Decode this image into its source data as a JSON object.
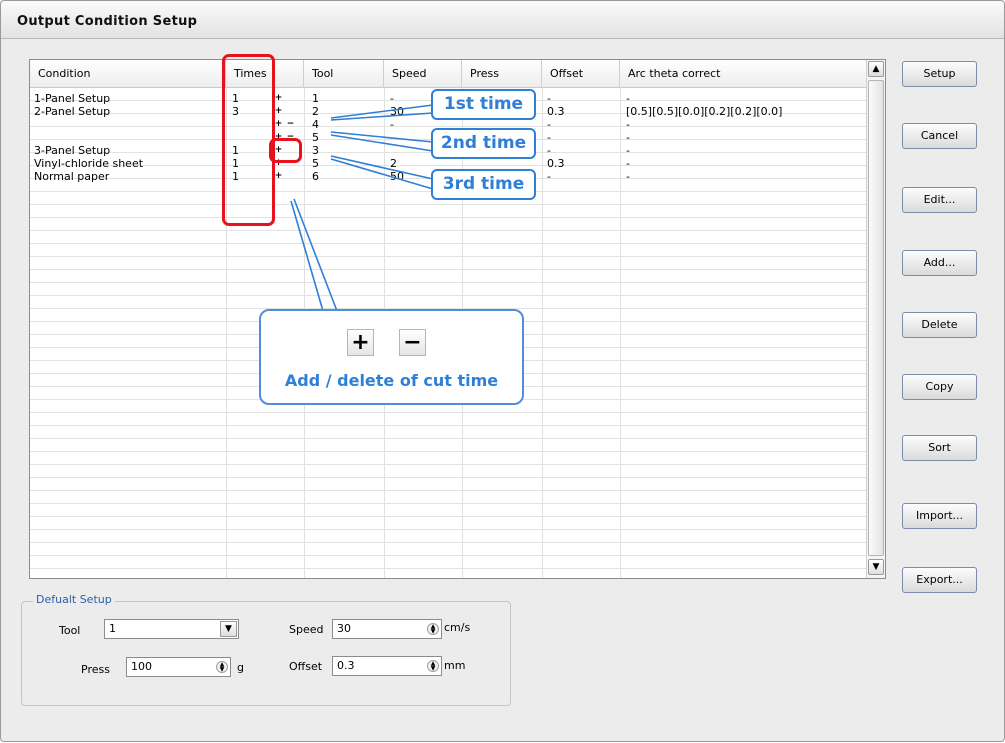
{
  "window": {
    "title": "Output Condition Setup"
  },
  "table": {
    "columns": [
      "Condition",
      "Times",
      "Tool",
      "Speed",
      "Press",
      "Offset",
      "Arc theta correct"
    ],
    "rows": [
      {
        "condition": "1-Panel Setup",
        "times": "1",
        "tool": "1",
        "speed": "-",
        "press": "",
        "offset": "-",
        "arc": "-"
      },
      {
        "condition": "2-Panel Setup",
        "times": "3",
        "tool": "2",
        "speed": "30",
        "press": "150",
        "offset": "0.3",
        "arc": "[0.5][0.5][0.0][0.2][0.2][0.0]"
      },
      {
        "condition": "",
        "times": "",
        "tool": "4",
        "speed": "-",
        "press": "",
        "offset": "-",
        "arc": "-"
      },
      {
        "condition": "",
        "times": "",
        "tool": "5",
        "speed": "-",
        "press": "",
        "offset": "-",
        "arc": "-"
      },
      {
        "condition": "3-Panel Setup",
        "times": "1",
        "tool": "3",
        "speed": "",
        "press": "",
        "offset": "-",
        "arc": "-"
      },
      {
        "condition": "Vinyl-chloride sheet",
        "times": "1",
        "tool": "5",
        "speed": "2",
        "press": "",
        "offset": "0.3",
        "arc": "-"
      },
      {
        "condition": "Normal paper",
        "times": "1",
        "tool": "6",
        "speed": "50",
        "press": "20",
        "offset": "-",
        "arc": "-"
      }
    ]
  },
  "buttons": {
    "setup": "Setup",
    "cancel": "Cancel",
    "edit": "Edit...",
    "add": "Add...",
    "delete": "Delete",
    "copy": "Copy",
    "sort": "Sort",
    "import": "Import...",
    "export": "Export..."
  },
  "default_setup": {
    "group_label": "Defualt Setup",
    "tool_label": "Tool",
    "tool_value": "1",
    "speed_label": "Speed",
    "speed_value": "30",
    "speed_unit": "cm/s",
    "press_label": "Press",
    "press_value": "100",
    "press_unit": "g",
    "offset_label": "Offset",
    "offset_value": "0.3",
    "offset_unit": "mm"
  },
  "annotations": {
    "first": "1st time",
    "second": "2nd time",
    "third": "3rd time",
    "add_delete": "Add / delete of cut time"
  },
  "icons": {
    "plus": "plus-icon",
    "minus": "minus-icon"
  },
  "colors": {
    "highlight": "#e8121d",
    "callout": "#2f7fd6"
  }
}
